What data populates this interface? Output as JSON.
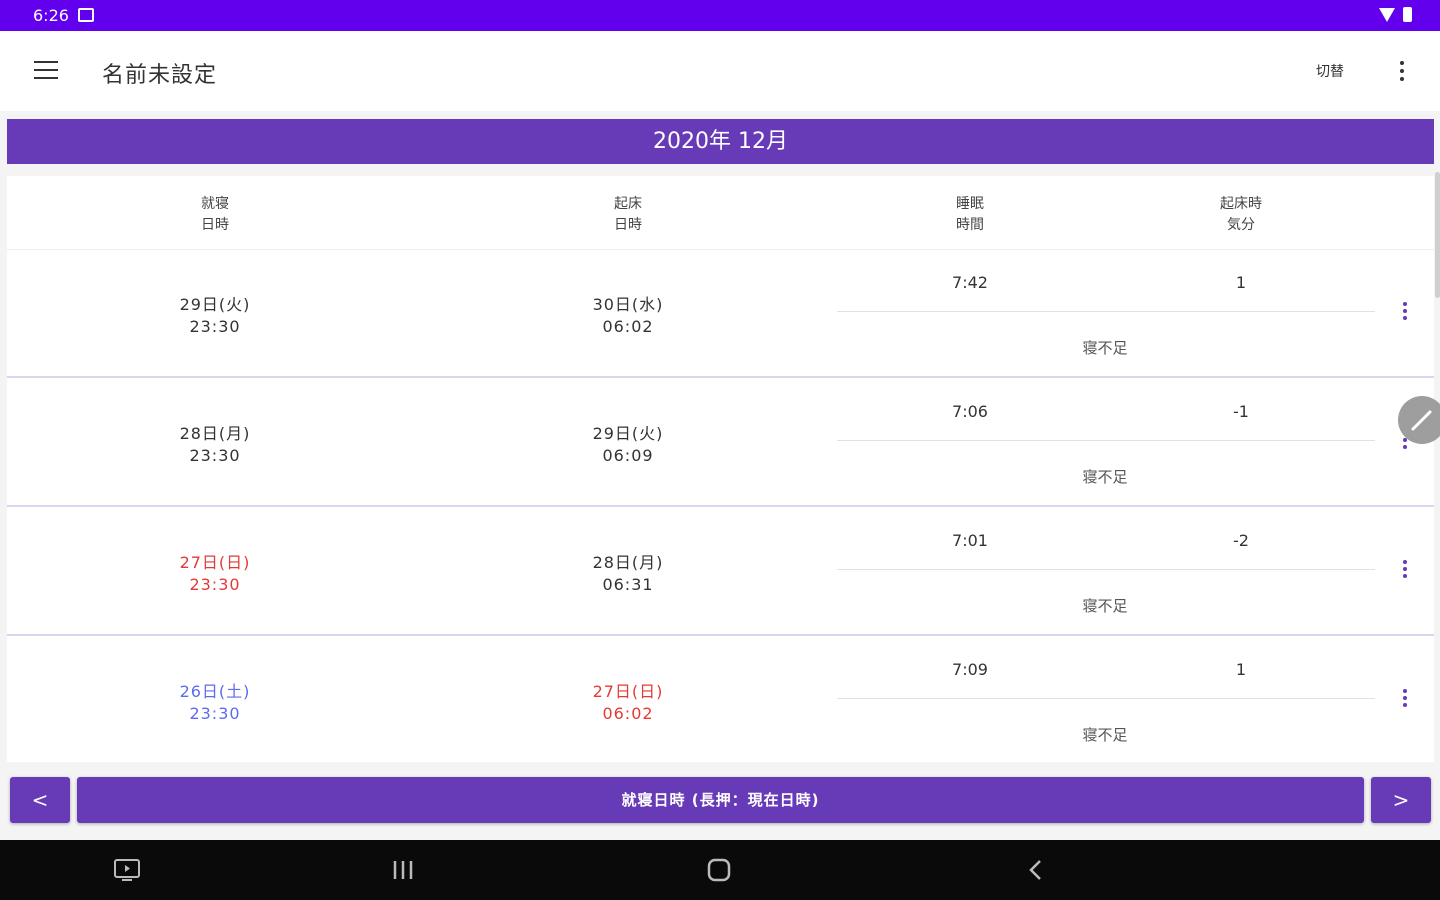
{
  "status_bar": {
    "time": "6:26"
  },
  "app_bar": {
    "title": "名前未設定",
    "switch_label": "切替"
  },
  "month_banner": "2020年 12月",
  "table": {
    "headers": [
      "就寝\n日時",
      "起床\n日時",
      "睡眠\n時間",
      "起床時\n気分"
    ],
    "rows": [
      {
        "bed_day": "29日(火)",
        "bed_time": "23:30",
        "wake_day": "30日(水)",
        "wake_time": "06:02",
        "sleep": "7:42",
        "mood": "1",
        "note": "寝不足",
        "bed_color": "#333333",
        "wake_color": "#333333"
      },
      {
        "bed_day": "28日(月)",
        "bed_time": "23:30",
        "wake_day": "29日(火)",
        "wake_time": "06:09",
        "sleep": "7:06",
        "mood": "-1",
        "note": "寝不足",
        "bed_color": "#333333",
        "wake_color": "#333333"
      },
      {
        "bed_day": "27日(日)",
        "bed_time": "23:30",
        "wake_day": "28日(月)",
        "wake_time": "06:31",
        "sleep": "7:01",
        "mood": "-2",
        "note": "寝不足",
        "bed_color": "#e53935",
        "wake_color": "#333333"
      },
      {
        "bed_day": "26日(土)",
        "bed_time": "23:30",
        "wake_day": "27日(日)",
        "wake_time": "06:02",
        "sleep": "7:09",
        "mood": "1",
        "note": "寝不足",
        "bed_color": "#5c6bf0",
        "wake_color": "#e53935"
      }
    ]
  },
  "bottom_bar": {
    "prev_label": "<",
    "main_label": "就寝日時 (長押：現在日時)",
    "next_label": ">"
  },
  "icons": {
    "menu": "menu-icon",
    "more": "more-vert-icon",
    "edit": "edit-icon"
  },
  "colors": {
    "status_bar": "#6200ee",
    "accent": "#673ab7",
    "sunday": "#e53935",
    "saturday": "#5c6bf0"
  }
}
